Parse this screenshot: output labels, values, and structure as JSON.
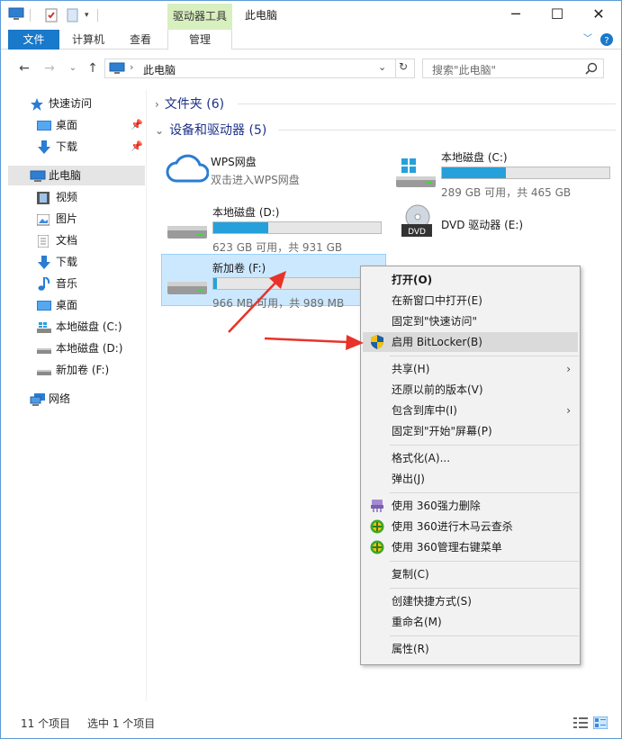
{
  "titlebar": {
    "context_tab": "驱动器工具",
    "title": "此电脑",
    "minimize": "─",
    "maximize": "☐",
    "close": "✕"
  },
  "ribbon": {
    "tabs": [
      {
        "label": "文件"
      },
      {
        "label": "计算机"
      },
      {
        "label": "查看"
      },
      {
        "label": "管理"
      }
    ]
  },
  "navbar": {
    "address": "此电脑",
    "search_placeholder": "搜索\"此电脑\""
  },
  "sidebar": {
    "items": [
      {
        "label": "快速访问"
      },
      {
        "label": "桌面"
      },
      {
        "label": "下载"
      },
      {
        "label": "此电脑"
      },
      {
        "label": "视频"
      },
      {
        "label": "图片"
      },
      {
        "label": "文档"
      },
      {
        "label": "下载"
      },
      {
        "label": "音乐"
      },
      {
        "label": "桌面"
      },
      {
        "label": "本地磁盘 (C:)"
      },
      {
        "label": "本地磁盘 (D:)"
      },
      {
        "label": "新加卷 (F:)"
      },
      {
        "label": "网络"
      }
    ]
  },
  "main": {
    "groups": [
      {
        "label": "文件夹 (6)"
      },
      {
        "label": "设备和驱动器 (5)"
      }
    ],
    "tiles": [
      {
        "name": "WPS网盘",
        "sub": "双击进入WPS网盘"
      },
      {
        "name": "本地磁盘 (C:)",
        "info": "289 GB 可用，共 465 GB",
        "used_fraction": 0.38
      },
      {
        "name": "本地磁盘 (D:)",
        "info": "623 GB 可用，共 931 GB",
        "used_fraction": 0.33
      },
      {
        "name": "DVD 驱动器 (E:)"
      },
      {
        "name": "新加卷 (F:)",
        "info": "966 MB 可用，共 989 MB",
        "used_fraction": 0.02
      }
    ]
  },
  "context_menu": {
    "items": [
      {
        "label": "打开(O)"
      },
      {
        "label": "在新窗口中打开(E)"
      },
      {
        "label": "固定到\"快速访问\""
      },
      {
        "label": "启用 BitLocker(B)"
      },
      {
        "label": "共享(H)"
      },
      {
        "label": "还原以前的版本(V)"
      },
      {
        "label": "包含到库中(I)"
      },
      {
        "label": "固定到\"开始\"屏幕(P)"
      },
      {
        "label": "格式化(A)..."
      },
      {
        "label": "弹出(J)"
      },
      {
        "label": "使用 360强力删除"
      },
      {
        "label": "使用 360进行木马云查杀"
      },
      {
        "label": "使用 360管理右键菜单"
      },
      {
        "label": "复制(C)"
      },
      {
        "label": "创建快捷方式(S)"
      },
      {
        "label": "重命名(M)"
      },
      {
        "label": "属性(R)"
      }
    ]
  },
  "status": {
    "count": "11 个项目",
    "selected": "选中 1 个项目"
  },
  "colors": {
    "accent": "#1979ca",
    "drive_bar": "#26a0da",
    "selection": "#cce8ff",
    "context_tab": "#d8efbf",
    "annotation_arrow": "#e8332a"
  }
}
